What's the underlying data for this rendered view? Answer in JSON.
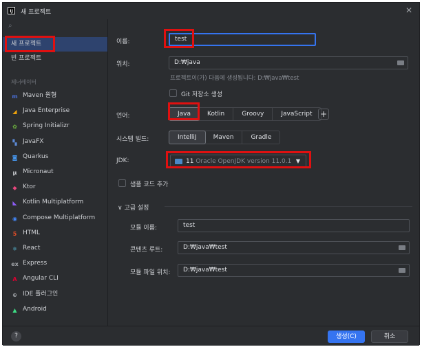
{
  "window": {
    "app_icon_text": "IJ",
    "title": "새 프로젝트",
    "close_glyph": "✕"
  },
  "sidebar": {
    "search_glyph": "⌕",
    "items": [
      {
        "label": "새 프로젝트",
        "selected": true
      },
      {
        "label": "빈 프로젝트",
        "selected": false
      }
    ],
    "section_label": "제너레이터",
    "generators": [
      {
        "label": "Maven 원형",
        "icon": "maven-icon",
        "glyph": "m",
        "color": "#4a6fd8"
      },
      {
        "label": "Java Enterprise",
        "icon": "java-enterprise-icon",
        "glyph": "◢",
        "color": "#f0a30a"
      },
      {
        "label": "Spring Initializr",
        "icon": "spring-icon",
        "glyph": "✿",
        "color": "#6db33f"
      },
      {
        "label": "JavaFX",
        "icon": "javafx-icon",
        "glyph": "▚",
        "color": "#5c8ad6"
      },
      {
        "label": "Quarkus",
        "icon": "quarkus-icon",
        "glyph": "◙",
        "color": "#4695eb"
      },
      {
        "label": "Micronaut",
        "icon": "micronaut-icon",
        "glyph": "μ",
        "color": "#cfd1d5"
      },
      {
        "label": "Ktor",
        "icon": "ktor-icon",
        "glyph": "◆",
        "color": "#e8477e"
      },
      {
        "label": "Kotlin Multiplatform",
        "icon": "kotlin-icon",
        "glyph": "◣",
        "color": "#8d5cf6"
      },
      {
        "label": "Compose Multiplatform",
        "icon": "compose-icon",
        "glyph": "◉",
        "color": "#4285f4"
      },
      {
        "label": "HTML",
        "icon": "html-icon",
        "glyph": "5",
        "color": "#e44d26"
      },
      {
        "label": "React",
        "icon": "react-icon",
        "glyph": "⚛",
        "color": "#61dafb"
      },
      {
        "label": "Express",
        "icon": "express-icon",
        "glyph": "ex",
        "color": "#a0a3a8"
      },
      {
        "label": "Angular CLI",
        "icon": "angular-icon",
        "glyph": "A",
        "color": "#dd0031"
      },
      {
        "label": "IDE 플러그인",
        "icon": "plugin-icon",
        "glyph": "⊕",
        "color": "#a0a3a8"
      },
      {
        "label": "Android",
        "icon": "android-icon",
        "glyph": "▲",
        "color": "#3ddc84"
      }
    ]
  },
  "form": {
    "name": {
      "label": "이름:",
      "value": "test"
    },
    "location": {
      "label": "위치:",
      "value": "D:₩java",
      "hint": "프로젝트이(가) 다음에 생성됩니다: D:₩java₩test"
    },
    "git": {
      "label": "Git 저장소 생성",
      "checked": false
    },
    "language": {
      "label": "언어:",
      "options": [
        "Java",
        "Kotlin",
        "Groovy",
        "JavaScript"
      ],
      "selected": "Java",
      "add_glyph": "+"
    },
    "build_system": {
      "label": "시스템 빌드:",
      "options": [
        "IntelliJ",
        "Maven",
        "Gradle"
      ],
      "selected": "IntelliJ"
    },
    "jdk": {
      "label": "JDK:",
      "version": "11",
      "vendor": "Oracle OpenJDK version 11.0.1",
      "chevron": "▼"
    },
    "sample_code": {
      "label": "샘플 코드 추가",
      "checked": false
    },
    "advanced": {
      "toggle_label": "고급 설정",
      "module_name": {
        "label": "모듈 이름:",
        "value": "test"
      },
      "content_root": {
        "label": "콘텐츠 루트:",
        "value": "D:₩java₩test"
      },
      "module_file": {
        "label": "모듈 파일 위치:",
        "value": "D:₩java₩test"
      }
    }
  },
  "footer": {
    "help_glyph": "?",
    "create_label": "생성(C)",
    "cancel_label": "취소"
  },
  "colors": {
    "accent": "#3574f0",
    "selection": "#2e436e",
    "highlight_box": "#e01010"
  }
}
